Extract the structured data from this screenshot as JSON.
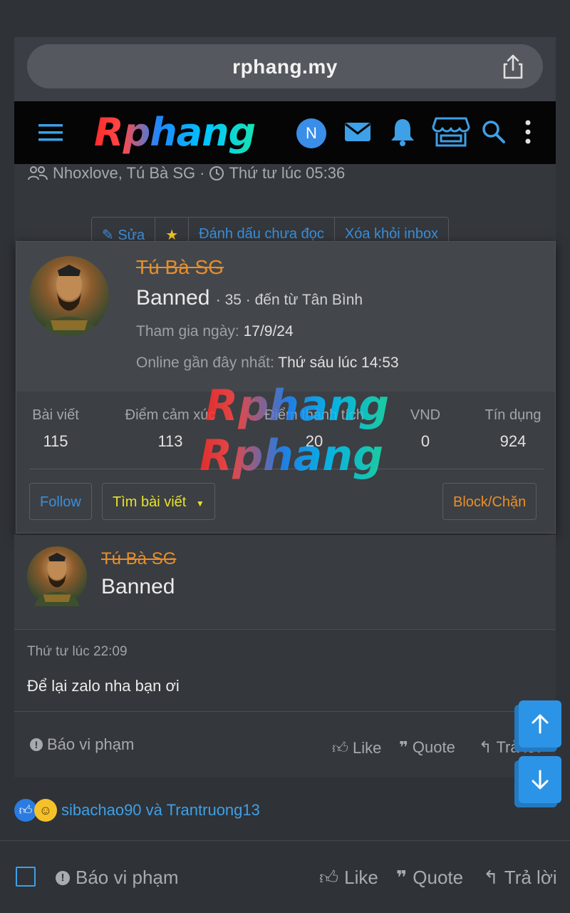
{
  "browser": {
    "url": "rphang.my"
  },
  "nav": {
    "brand": "Rphang",
    "avatar_initial": "N"
  },
  "thread": {
    "participants": "Nhoxlove, Tú Bà SG",
    "started": "Thứ tư lúc 05:36",
    "actions": [
      "Sửa",
      "Đánh dấu chưa đọc",
      "Xóa khỏi inbox"
    ]
  },
  "popup": {
    "username": "Tú Bà SG",
    "title": "Banned",
    "details": "· 35 · đến từ Tân Bình",
    "joined_label": "Tham gia ngày:",
    "joined_value": "17/9/24",
    "online_label": "Online gần đây nhất:",
    "online_value": "Thứ sáu lúc 14:53",
    "stats": [
      {
        "label": "Bài viết",
        "value": "115"
      },
      {
        "label": "Điểm cảm xúc",
        "value": "113"
      },
      {
        "label": "Điểm thành tích",
        "value": "20"
      },
      {
        "label": "VND",
        "value": "0"
      },
      {
        "label": "Tín dụng",
        "value": "924"
      }
    ],
    "follow": "Follow",
    "find_posts": "Tìm bài viết",
    "block": "Block/Chặn"
  },
  "watermark": "Rphang",
  "post": {
    "username": "Tú Bà SG",
    "user_title": "Banned",
    "date": "Thứ tư lúc 22:09",
    "text": "Để lại zalo nha bạn ơi",
    "report": "Báo vi phạm",
    "like": "Like",
    "quote": "Quote",
    "reply": "Trả lời"
  },
  "reactions": {
    "text": "sibachao90 và Trantruong13"
  },
  "bottom": {
    "report": "Báo vi phạm",
    "like": "Like",
    "quote": "Quote",
    "reply": "Trả lời"
  },
  "colors": {
    "accent": "#3ea0e6",
    "banned_name": "#e88e2a",
    "follow_btn": "#3b8fdc",
    "find_btn": "#e8e22a",
    "block_btn": "#e8902a"
  }
}
